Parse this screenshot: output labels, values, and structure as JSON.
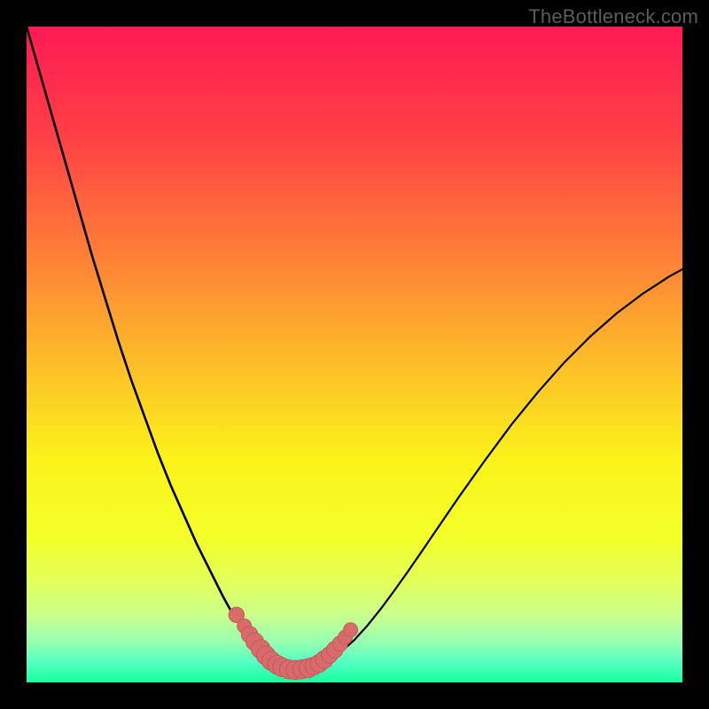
{
  "watermark": "TheBottleneck.com",
  "colors": {
    "frame": "#000000",
    "gradient_stops": [
      {
        "offset": 0.0,
        "color": "#ff1a55"
      },
      {
        "offset": 0.16,
        "color": "#ff3e46"
      },
      {
        "offset": 0.34,
        "color": "#fe7c38"
      },
      {
        "offset": 0.52,
        "color": "#fdc028"
      },
      {
        "offset": 0.66,
        "color": "#fbf31a"
      },
      {
        "offset": 0.78,
        "color": "#f3ff2a"
      },
      {
        "offset": 0.85,
        "color": "#e2ff5d"
      },
      {
        "offset": 0.9,
        "color": "#c7ff8e"
      },
      {
        "offset": 0.94,
        "color": "#95ffb4"
      },
      {
        "offset": 0.97,
        "color": "#52ffc2"
      },
      {
        "offset": 1.0,
        "color": "#18ff9f"
      }
    ],
    "curve_stroke": "#000000",
    "marker_fill": "#d86b6b",
    "marker_stroke": "#c95858"
  },
  "chart_data": {
    "type": "line",
    "title": "",
    "xlabel": "",
    "ylabel": "",
    "xlim": [
      0,
      100
    ],
    "ylim": [
      0,
      100
    ],
    "series": [
      {
        "name": "left-curve",
        "x": [
          0,
          2,
          4,
          6,
          8,
          10,
          12,
          14,
          16,
          18,
          20,
          22,
          24,
          26,
          28,
          30,
          31,
          32,
          33,
          34,
          35,
          36,
          37,
          38,
          39
        ],
        "y": [
          100,
          93,
          86,
          79,
          72,
          65,
          58.5,
          52,
          46,
          40.5,
          35,
          30,
          25.5,
          21,
          17,
          13,
          11.2,
          9.6,
          8.1,
          6.7,
          5.5,
          4.5,
          3.6,
          2.9,
          2.3
        ]
      },
      {
        "name": "right-curve",
        "x": [
          44,
          45,
          46,
          47,
          48,
          50,
          52,
          54,
          56,
          58,
          60,
          63,
          66,
          70,
          74,
          78,
          82,
          86,
          90,
          94,
          98,
          100
        ],
        "y": [
          2.2,
          2.6,
          3.2,
          3.9,
          4.7,
          6.5,
          8.7,
          11.2,
          13.9,
          16.7,
          19.6,
          24.0,
          28.4,
          34.0,
          39.4,
          44.3,
          48.8,
          52.8,
          56.3,
          59.3,
          61.9,
          63.0
        ]
      },
      {
        "name": "floor-segment",
        "x": [
          37,
          38,
          39,
          40,
          41,
          42,
          43,
          44,
          45
        ],
        "y": [
          2.4,
          1.9,
          1.6,
          1.5,
          1.5,
          1.55,
          1.7,
          2.0,
          2.4
        ]
      }
    ],
    "markers": [
      {
        "x": 32.0,
        "y": 10.3,
        "r": 1.3
      },
      {
        "x": 33.2,
        "y": 8.6,
        "r": 1.2
      },
      {
        "x": 34.0,
        "y": 7.3,
        "r": 1.4
      },
      {
        "x": 34.8,
        "y": 6.2,
        "r": 1.5
      },
      {
        "x": 35.7,
        "y": 5.1,
        "r": 1.6
      },
      {
        "x": 36.5,
        "y": 4.1,
        "r": 1.6
      },
      {
        "x": 37.3,
        "y": 3.3,
        "r": 1.6
      },
      {
        "x": 38.2,
        "y": 2.7,
        "r": 1.6
      },
      {
        "x": 39.0,
        "y": 2.3,
        "r": 1.6
      },
      {
        "x": 40.0,
        "y": 2.0,
        "r": 1.6
      },
      {
        "x": 41.0,
        "y": 1.9,
        "r": 1.6
      },
      {
        "x": 42.0,
        "y": 2.0,
        "r": 1.6
      },
      {
        "x": 43.0,
        "y": 2.2,
        "r": 1.6
      },
      {
        "x": 43.8,
        "y": 2.5,
        "r": 1.5
      },
      {
        "x": 44.6,
        "y": 2.9,
        "r": 1.5
      },
      {
        "x": 45.4,
        "y": 3.5,
        "r": 1.5
      },
      {
        "x": 46.2,
        "y": 4.2,
        "r": 1.4
      },
      {
        "x": 47.0,
        "y": 5.0,
        "r": 1.4
      },
      {
        "x": 47.8,
        "y": 5.9,
        "r": 1.3
      },
      {
        "x": 48.6,
        "y": 6.9,
        "r": 1.2
      },
      {
        "x": 49.4,
        "y": 8.0,
        "r": 1.2
      }
    ]
  }
}
